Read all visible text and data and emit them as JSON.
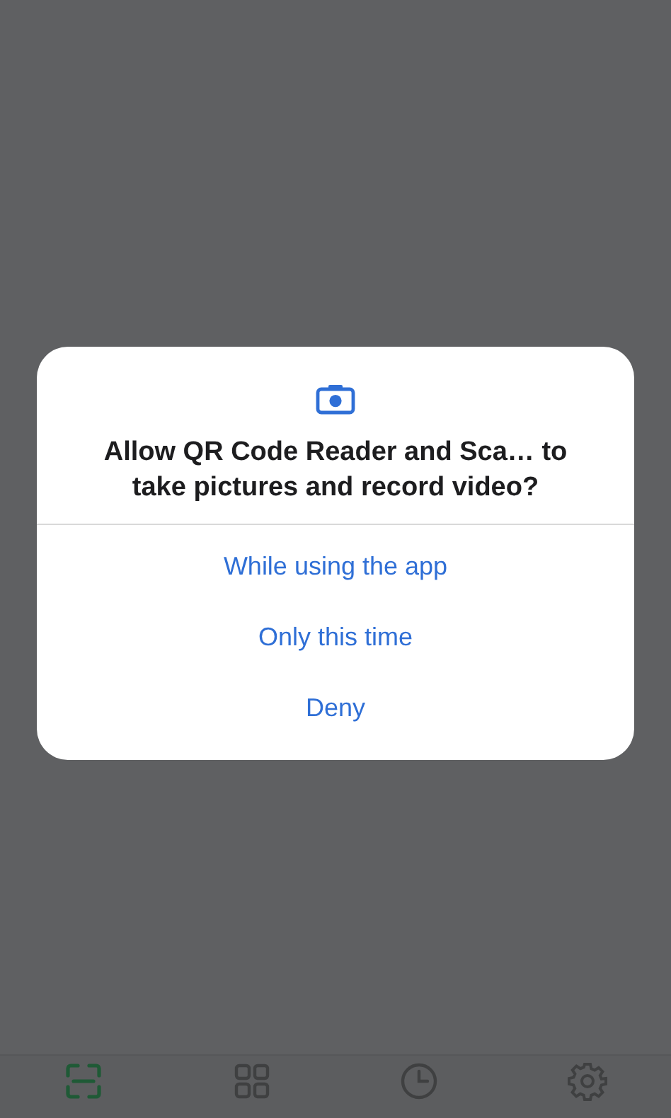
{
  "dialog": {
    "title": "Allow QR Code Reader and Sca… to take pictures and record video?",
    "options": [
      "While using the app",
      "Only this time",
      "Deny"
    ]
  },
  "nav": [
    {
      "kind": "scan",
      "selected": true
    },
    {
      "kind": "grid",
      "selected": false
    },
    {
      "kind": "clock",
      "selected": false
    },
    {
      "kind": "gear",
      "selected": false
    }
  ]
}
